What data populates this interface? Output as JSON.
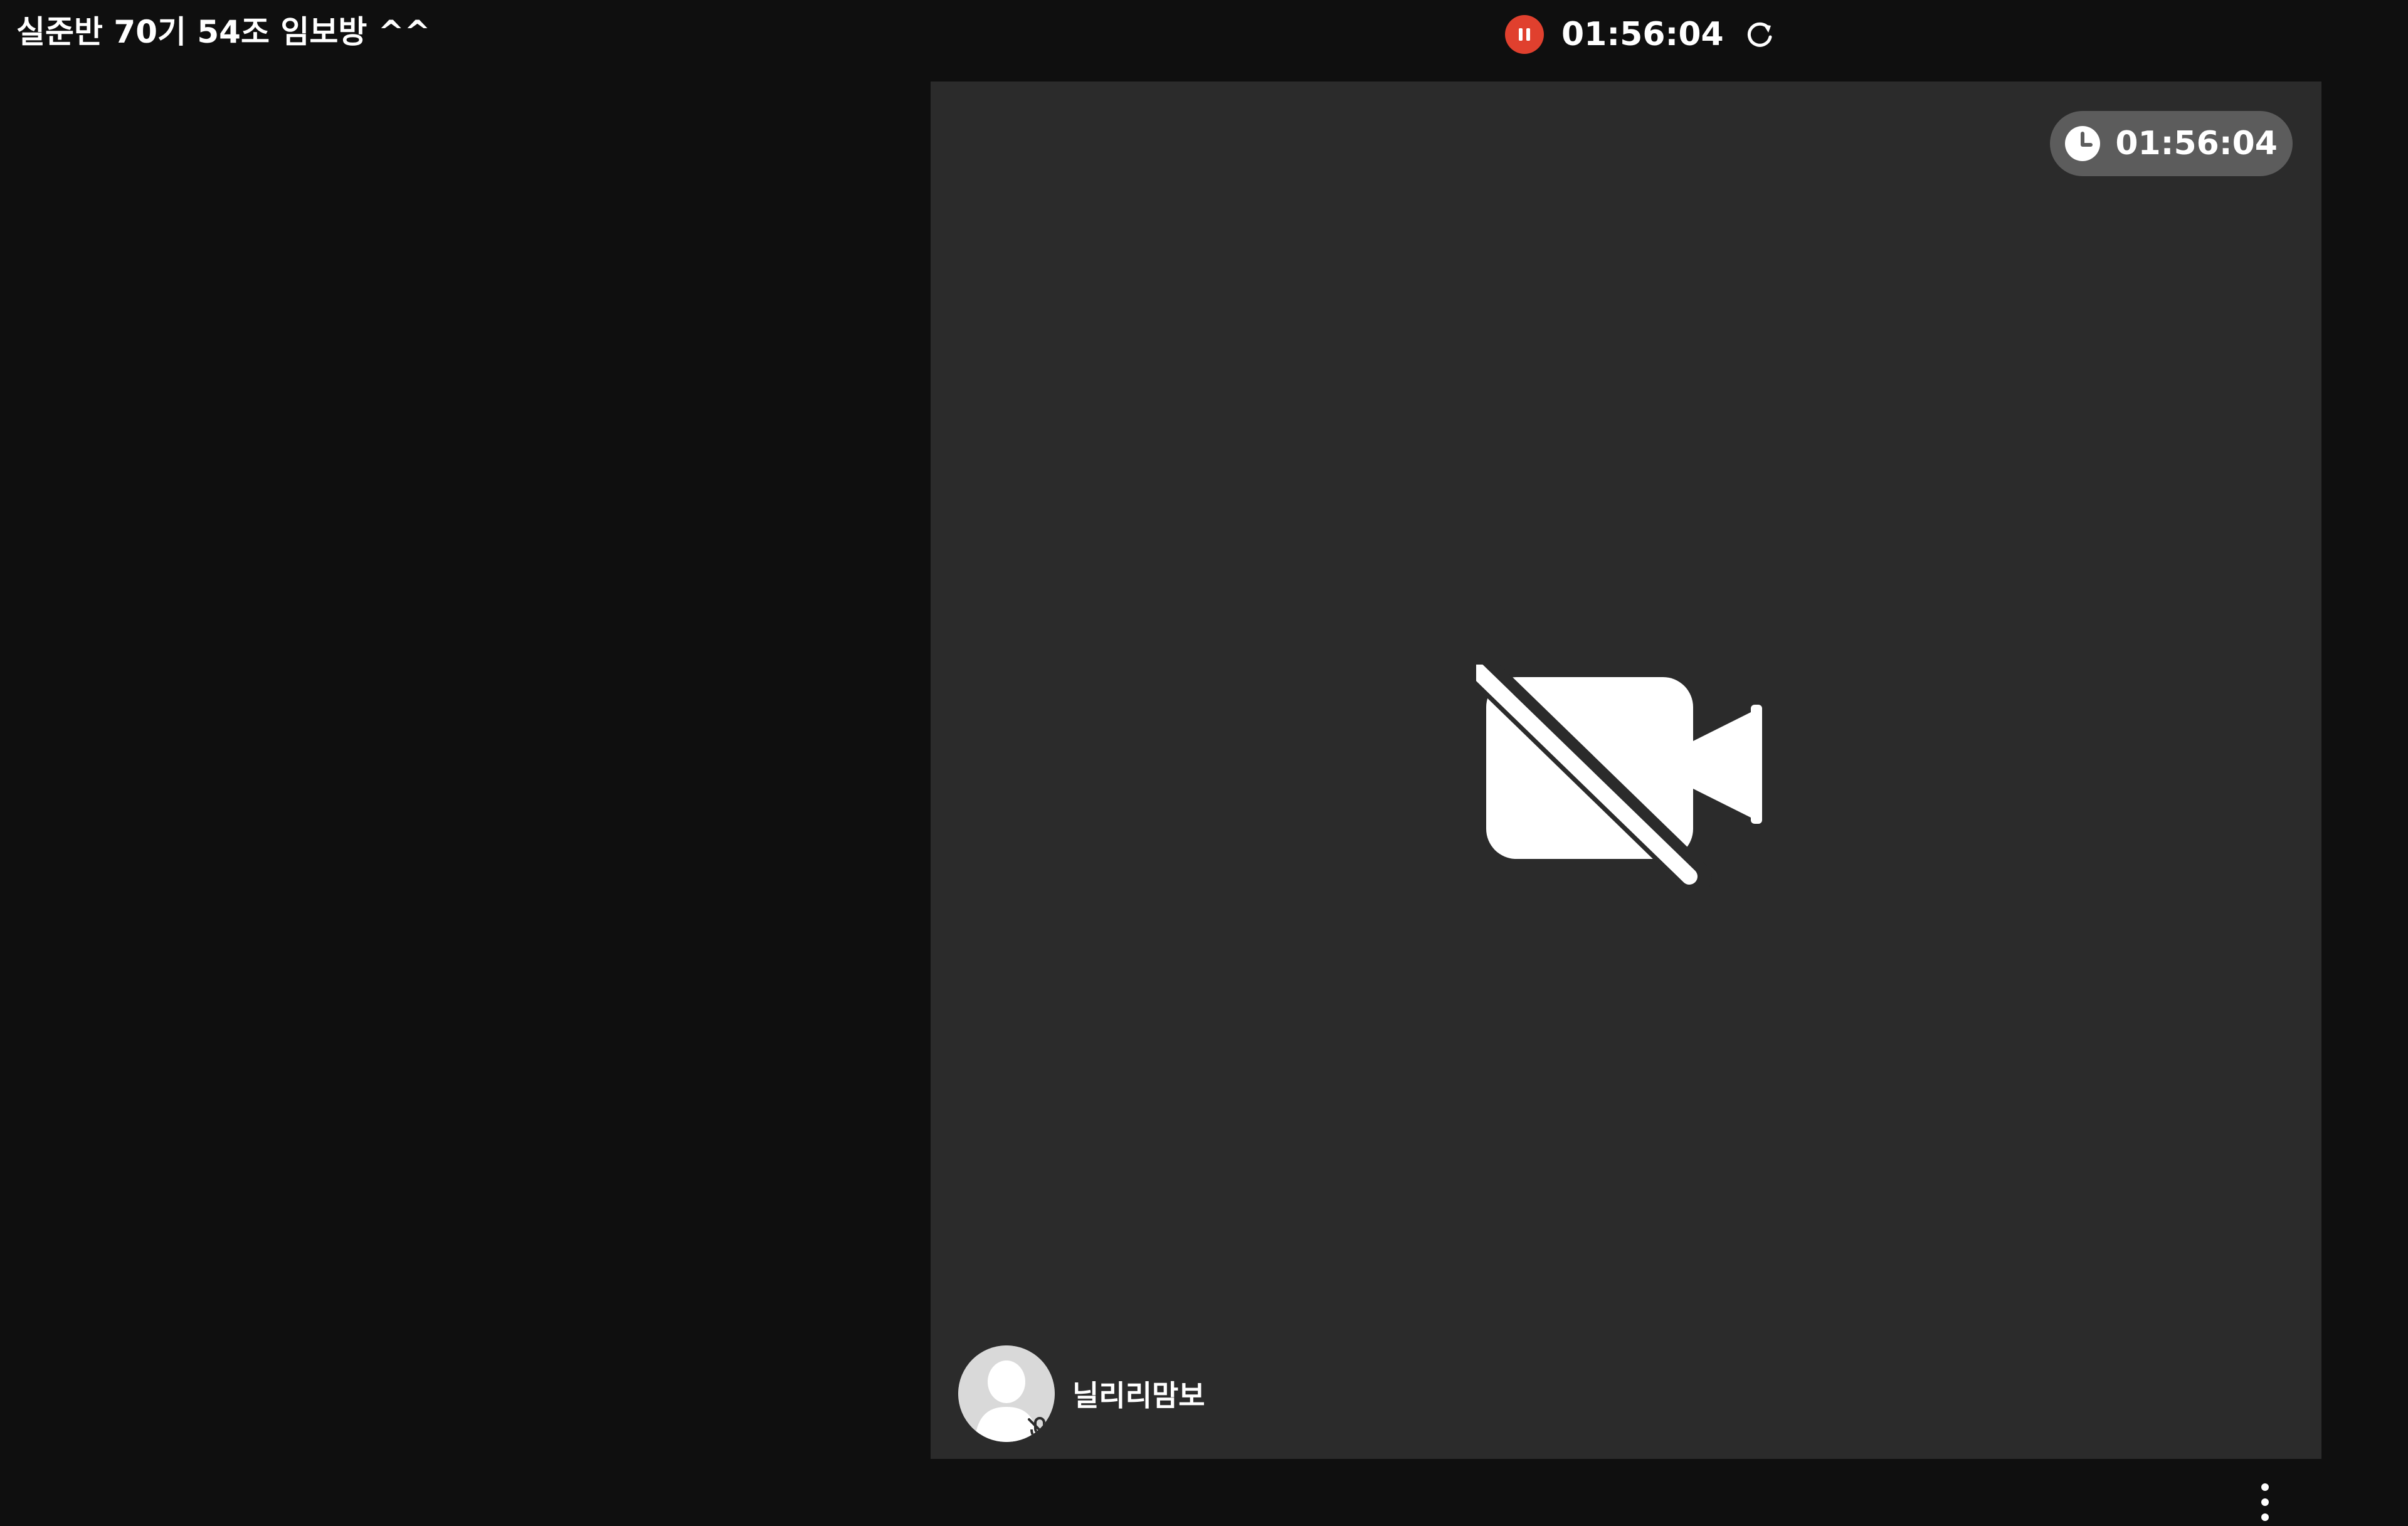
{
  "header": {
    "room_title": "실준반 70기 54조 임보방 ^^",
    "recording_timer": "01:56:04",
    "pause_icon": "pause-circle-icon",
    "refresh_icon": "refresh-icon"
  },
  "video_tile": {
    "elapsed_time": "01:56:04",
    "clock_icon": "clock-icon",
    "camera_status_icon": "video-off-icon",
    "participant": {
      "name": "닐리리맘보",
      "avatar_icon": "user-avatar-icon",
      "mic_status_icon": "mic-off-icon"
    },
    "more_icon": "more-vertical-icon"
  },
  "colors": {
    "background": "#0f0f0f",
    "tile": "#2b2b2b",
    "recording_accent": "#e0402e",
    "chip": "#5c5c5c"
  }
}
